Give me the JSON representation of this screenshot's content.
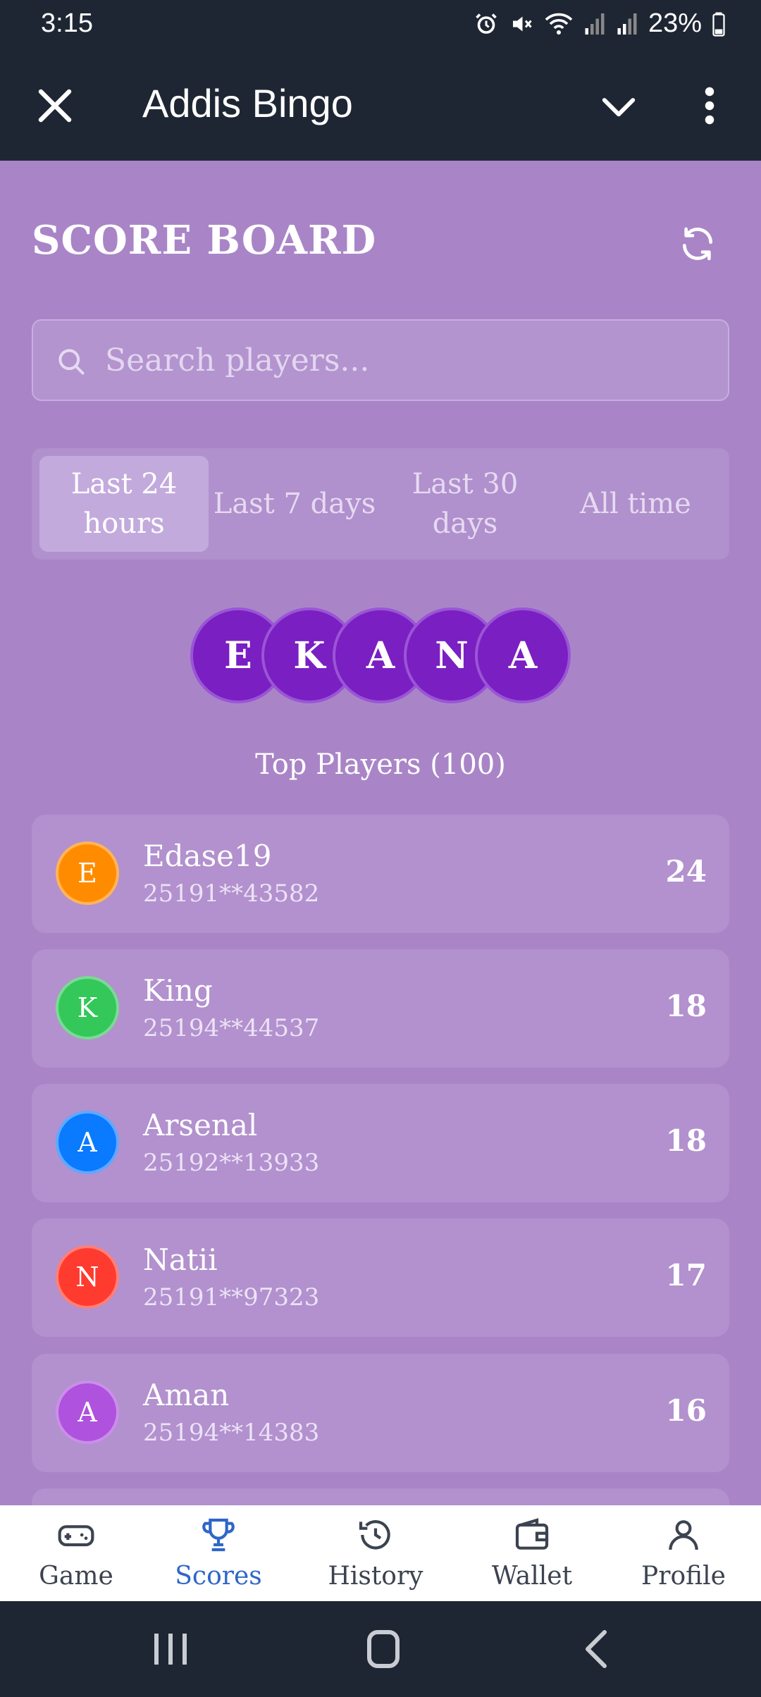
{
  "status_bar": {
    "time": "3:15",
    "battery": "23%"
  },
  "header": {
    "title": "Addis Bingo"
  },
  "scoreboard": {
    "title": "SCORE BOARD",
    "search_placeholder": "Search players...",
    "tabs": [
      {
        "label": "Last 24 hours",
        "active": true
      },
      {
        "label": "Last 7 days",
        "active": false
      },
      {
        "label": "Last 30 days",
        "active": false
      },
      {
        "label": "All time",
        "active": false
      }
    ],
    "initials": [
      "E",
      "K",
      "A",
      "N",
      "A"
    ],
    "top_players_label": "Top Players (100)",
    "players": [
      {
        "initial": "E",
        "name": "Edase19",
        "phone": "25191**43582",
        "score": "24",
        "color": "#ff8c00"
      },
      {
        "initial": "K",
        "name": "King",
        "phone": "25194**44537",
        "score": "18",
        "color": "#34c759"
      },
      {
        "initial": "A",
        "name": "Arsenal",
        "phone": "25192**13933",
        "score": "18",
        "color": "#0a7aff"
      },
      {
        "initial": "N",
        "name": "Natii",
        "phone": "25191**97323",
        "score": "17",
        "color": "#ff3b30"
      },
      {
        "initial": "A",
        "name": "Aman",
        "phone": "25194**14383",
        "score": "16",
        "color": "#af52de"
      }
    ]
  },
  "bottom_nav": {
    "items": [
      {
        "label": "Game",
        "icon": "gamepad-icon",
        "active": false
      },
      {
        "label": "Scores",
        "icon": "trophy-icon",
        "active": true
      },
      {
        "label": "History",
        "icon": "history-icon",
        "active": false
      },
      {
        "label": "Wallet",
        "icon": "wallet-icon",
        "active": false
      },
      {
        "label": "Profile",
        "icon": "profile-icon",
        "active": false
      }
    ]
  },
  "colors": {
    "background": "#a985c7",
    "accent": "#2f66c7",
    "initial_circle": "#7a1fc2"
  }
}
